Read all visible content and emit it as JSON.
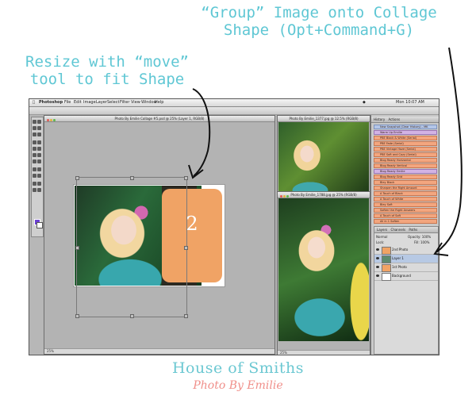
{
  "annotations": {
    "group_line1": "“Group” Image onto Collage",
    "group_line2": "Shape (Opt+Command+G)",
    "resize_line1": "Resize with “move”",
    "resize_line2": "tool to fit Shape"
  },
  "caption": {
    "house": "House of Smiths",
    "photo_by": "Photo By Emilie"
  },
  "menubar": {
    "app": "Photoshop",
    "items": [
      "File",
      "Edit",
      "Image",
      "Layer",
      "Select",
      "Filter",
      "View",
      "Window",
      "Help"
    ],
    "clock": "Mon 10:07 AM"
  },
  "windows": {
    "collage_title": "Photo By Emilie Collage #5.psd @ 25% (Layer 1, RGB/8)",
    "photo1_title": "Photo By Emilie_1377.jpg @ 12.5% (RGB/8)",
    "photo2_title": "Photo By Emilie_1788.jpg @ 25% (RGB/8)",
    "collage_zoom": "25%",
    "photo2_zoom": "25%"
  },
  "collage": {
    "shape_number": "2"
  },
  "panels": {
    "actions_tabs": [
      "History",
      "Actions"
    ],
    "actions": [
      {
        "label": "New Snapshot (Clear History) - MK",
        "style": "blue"
      },
      {
        "label": "Warm Up Emilie",
        "style": "purple"
      },
      {
        "label": "PBE Black & White (Serial)",
        "style": ""
      },
      {
        "label": "PBE Fade (Serial)",
        "style": ""
      },
      {
        "label": "PBE Vintage Haze (Serial)",
        "style": ""
      },
      {
        "label": "PBE Soft and Cozy (Serial)",
        "style": ""
      },
      {
        "label": "Blog Ready Horizontal",
        "style": ""
      },
      {
        "label": "Blog Ready Vertical",
        "style": ""
      },
      {
        "label": "Blog Ready Emilie",
        "style": "purple"
      },
      {
        "label": "Blog Ready Grid",
        "style": ""
      },
      {
        "label": "Bley Black",
        "style": ""
      },
      {
        "label": "Sharpen the Right Amount",
        "style": ""
      },
      {
        "label": "A Touch of Black",
        "style": ""
      },
      {
        "label": "A Touch of White",
        "style": ""
      },
      {
        "label": "Bley Soft",
        "style": ""
      },
      {
        "label": "Soften the Right Answers",
        "style": ""
      },
      {
        "label": "A Touch of Soft",
        "style": ""
      },
      {
        "label": "All in 1 Soften",
        "style": ""
      }
    ],
    "layers_tabs": [
      "Layers",
      "Channels",
      "Paths"
    ],
    "blend_mode": "Normal",
    "opacity_label": "Opacity:",
    "opacity_value": "100%",
    "lock_label": "Lock:",
    "fill_label": "Fill:",
    "fill_value": "100%",
    "layers": [
      {
        "name": "2nd Photo",
        "thumb": "#f0a365",
        "selected": false
      },
      {
        "name": "Layer 1",
        "thumb": "#5c8a6e",
        "selected": true
      },
      {
        "name": "1st Photo",
        "thumb": "#f0a365",
        "selected": false
      },
      {
        "name": "Background",
        "thumb": "#ffffff",
        "selected": false
      }
    ]
  },
  "colors": {
    "annotation": "#5fc7d4",
    "caption_house": "#6cc8d2",
    "caption_photo": "#f08f8a",
    "shape_orange": "#f0a365"
  },
  "icons": [
    "move-tool-icon",
    "marquee-tool-icon",
    "lasso-tool-icon",
    "crop-tool-icon",
    "brush-tool-icon",
    "type-tool-icon",
    "eye-icon",
    "apple-icon",
    "wifi-icon"
  ]
}
